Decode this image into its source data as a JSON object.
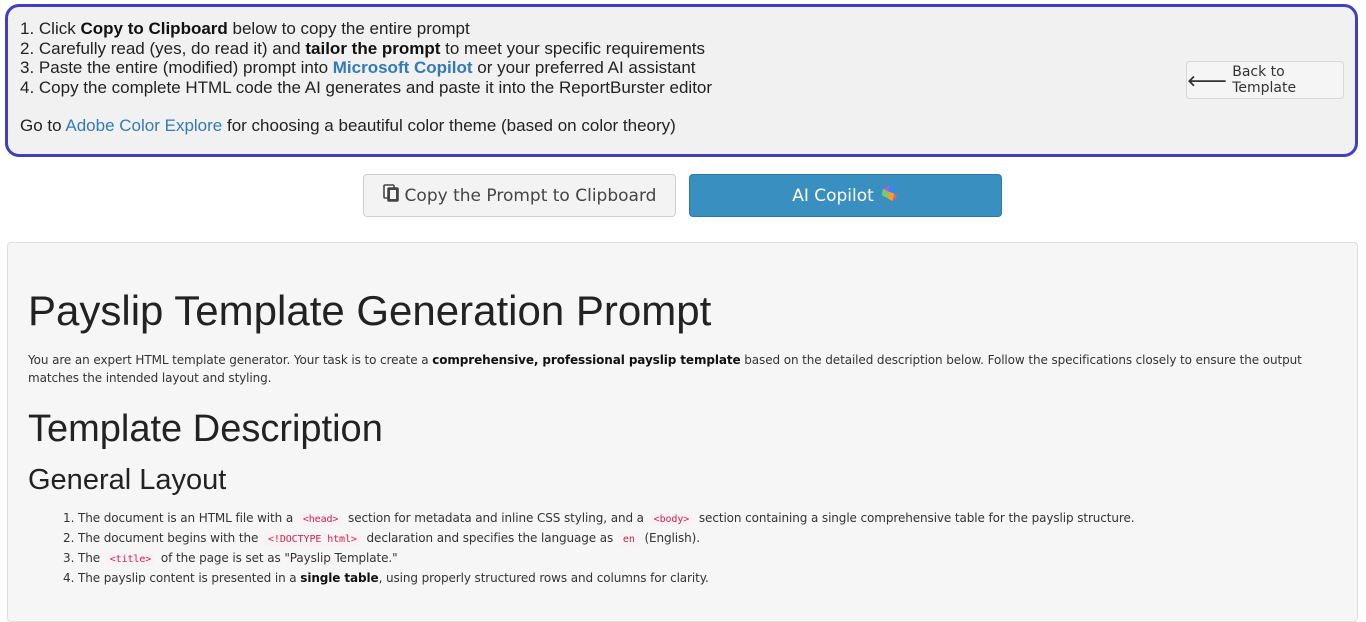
{
  "instructions": {
    "step1": {
      "prefix": "1. Click ",
      "bold": "Copy to Clipboard",
      "suffix": " below to copy the entire prompt"
    },
    "step2": {
      "prefix": "2. Carefully read (yes, do read it) and ",
      "bold": "tailor the prompt",
      "suffix": " to meet your specific requirements"
    },
    "step3": {
      "prefix": "3. Paste the entire (modified) prompt into ",
      "link": "Microsoft Copilot",
      "suffix": " or your preferred AI assistant"
    },
    "step4": {
      "text": "4. Copy the complete HTML code the AI generates and paste it into the ReportBurster editor"
    },
    "footnote": {
      "prefix": "Go to ",
      "link": "Adobe Color Explore",
      "suffix": " for choosing a beautiful color theme (based on color theory)"
    },
    "back_button": "Back to Template"
  },
  "actions": {
    "copy_button": "Copy the Prompt to Clipboard",
    "copilot_button": "AI Copilot"
  },
  "prompt": {
    "title": "Payslip Template Generation Prompt",
    "intro": {
      "prefix": "You are an expert HTML template generator. Your task is to create a ",
      "bold": "comprehensive, professional payslip template",
      "suffix": " based on the detailed description below. Follow the specifications closely to ensure the output matches the intended layout and styling."
    },
    "section_title": "Template Description",
    "subsection_title": "General Layout",
    "items": {
      "i1": {
        "a": "The document is an HTML file with a ",
        "code1": "<head>",
        "b": " section for metadata and inline CSS styling, and a ",
        "code2": "<body>",
        "c": " section containing a single comprehensive table for the payslip structure."
      },
      "i2": {
        "a": "The document begins with the ",
        "code1": "<!DOCTYPE html>",
        "b": " declaration and specifies the language as ",
        "code2": "en",
        "c": " (English)."
      },
      "i3": {
        "a": "The ",
        "code1": "<title>",
        "b": " of the page is set as \"Payslip Template.\""
      },
      "i4": {
        "a": "The payslip content is presented in a ",
        "bold": "single table",
        "b": ", using properly structured rows and columns for clarity."
      }
    }
  },
  "colors": {
    "instructions_border": "#3f3fbf",
    "link": "#337ab7",
    "copilot_button_bg": "#3a8fc1",
    "code_text": "#c7254e"
  },
  "icons": {
    "back": "arrow-left-icon",
    "copy": "copy-icon",
    "copilot": "copilot-logo-icon"
  }
}
